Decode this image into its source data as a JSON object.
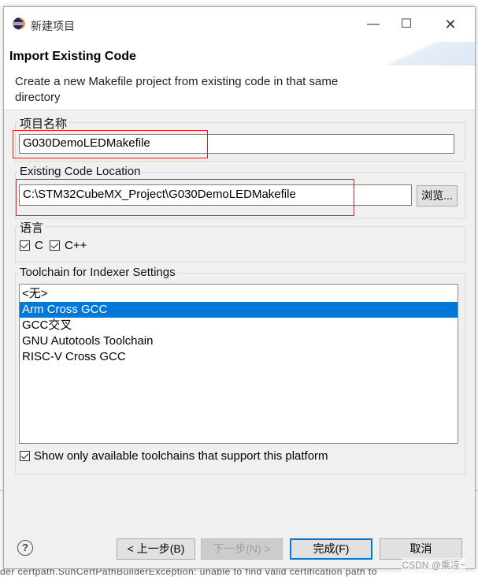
{
  "window": {
    "title": "新建项目",
    "controls": {
      "minimize": "—",
      "maximize": "☐",
      "close": "✕"
    }
  },
  "header": {
    "title": "Import Existing Code",
    "description": "Create a new Makefile project from existing code in that same directory"
  },
  "project_name": {
    "label": "项目名称",
    "value": "G030DemoLEDMakefile"
  },
  "code_location": {
    "label": "Existing Code Location",
    "value": "C:\\STM32CubeMX_Project\\G030DemoLEDMakefile",
    "browse_label": "浏览..."
  },
  "languages": {
    "label": "语言",
    "items": [
      {
        "label": "C",
        "checked": true
      },
      {
        "label": "C++",
        "checked": true
      }
    ]
  },
  "toolchain": {
    "label": "Toolchain for Indexer Settings",
    "items": [
      "<无>",
      "Arm Cross GCC",
      "GCC交叉",
      "GNU Autotools Toolchain",
      "RISC-V Cross GCC"
    ],
    "selected_index": 1,
    "show_only_label": "Show only available toolchains that support this platform",
    "show_only_checked": true
  },
  "footer": {
    "help": "?",
    "back_label": "< 上一步(B)",
    "next_label": "下一步(N) >",
    "finish_label": "完成(F)",
    "cancel_label": "取消"
  },
  "watermark": "CSDN @乘凉~",
  "background_text": "der certpath.SunCertPathBuilderException: unable to find valid certification path to",
  "colors": {
    "accent": "#0078d7",
    "highlight_box": "#e02020"
  }
}
